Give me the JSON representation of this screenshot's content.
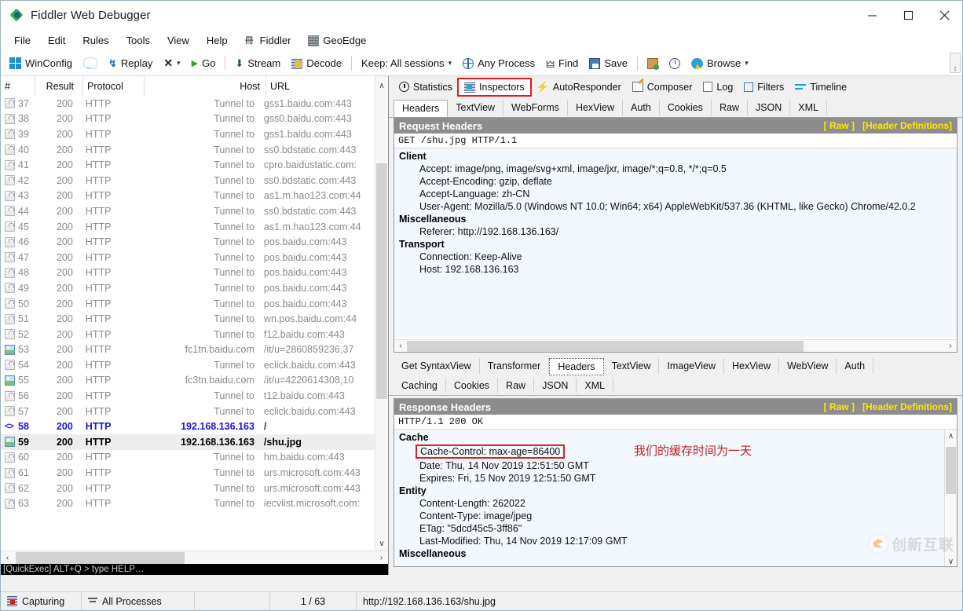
{
  "window": {
    "title": "Fiddler Web Debugger",
    "minimize": "—",
    "maximize": "□",
    "close": "✕"
  },
  "menu": {
    "items": [
      {
        "label": "File",
        "icon": ""
      },
      {
        "label": "Edit",
        "icon": ""
      },
      {
        "label": "Rules",
        "icon": ""
      },
      {
        "label": "Tools",
        "icon": ""
      },
      {
        "label": "View",
        "icon": ""
      },
      {
        "label": "Help",
        "icon": ""
      },
      {
        "label": "Fiddler",
        "icon": "fiddler-book-icon"
      },
      {
        "label": "GeoEdge",
        "icon": "geoedge-icon"
      }
    ]
  },
  "toolbar": {
    "winconfig": "WinConfig",
    "replay": "Replay",
    "go": "Go",
    "stream": "Stream",
    "decode": "Decode",
    "keep": "Keep: All sessions",
    "process": "Any Process",
    "find": "Find",
    "save": "Save",
    "browse": "Browse",
    "dropdown_caret": "▾",
    "x_label": "✕",
    "scroll_glyph": "↕"
  },
  "sessions": {
    "columns": [
      "#",
      "Result",
      "Protocol",
      "Host",
      "URL"
    ],
    "rows": [
      {
        "icon": "lock-icon",
        "num": "37",
        "result": "200",
        "protocol": "HTTP",
        "host": "Tunnel to",
        "url": "gss1.baidu.com:443",
        "style": "normal"
      },
      {
        "icon": "lock-icon",
        "num": "38",
        "result": "200",
        "protocol": "HTTP",
        "host": "Tunnel to",
        "url": "gss0.baidu.com:443",
        "style": "normal"
      },
      {
        "icon": "lock-icon",
        "num": "39",
        "result": "200",
        "protocol": "HTTP",
        "host": "Tunnel to",
        "url": "gss1.baidu.com:443",
        "style": "normal"
      },
      {
        "icon": "lock-icon",
        "num": "40",
        "result": "200",
        "protocol": "HTTP",
        "host": "Tunnel to",
        "url": "ss0.bdstatic.com:443",
        "style": "normal"
      },
      {
        "icon": "lock-icon",
        "num": "41",
        "result": "200",
        "protocol": "HTTP",
        "host": "Tunnel to",
        "url": "cpro.baidustatic.com:",
        "style": "normal"
      },
      {
        "icon": "lock-icon",
        "num": "42",
        "result": "200",
        "protocol": "HTTP",
        "host": "Tunnel to",
        "url": "ss0.bdstatic.com:443",
        "style": "normal"
      },
      {
        "icon": "lock-icon",
        "num": "43",
        "result": "200",
        "protocol": "HTTP",
        "host": "Tunnel to",
        "url": "as1.m.hao123.com:44",
        "style": "normal"
      },
      {
        "icon": "lock-icon",
        "num": "44",
        "result": "200",
        "protocol": "HTTP",
        "host": "Tunnel to",
        "url": "ss0.bdstatic.com:443",
        "style": "normal"
      },
      {
        "icon": "lock-icon",
        "num": "45",
        "result": "200",
        "protocol": "HTTP",
        "host": "Tunnel to",
        "url": "as1.m.hao123.com:44",
        "style": "normal"
      },
      {
        "icon": "lock-icon",
        "num": "46",
        "result": "200",
        "protocol": "HTTP",
        "host": "Tunnel to",
        "url": "pos.baidu.com:443",
        "style": "normal"
      },
      {
        "icon": "lock-icon",
        "num": "47",
        "result": "200",
        "protocol": "HTTP",
        "host": "Tunnel to",
        "url": "pos.baidu.com:443",
        "style": "normal"
      },
      {
        "icon": "lock-icon",
        "num": "48",
        "result": "200",
        "protocol": "HTTP",
        "host": "Tunnel to",
        "url": "pos.baidu.com:443",
        "style": "normal"
      },
      {
        "icon": "lock-icon",
        "num": "49",
        "result": "200",
        "protocol": "HTTP",
        "host": "Tunnel to",
        "url": "pos.baidu.com:443",
        "style": "normal"
      },
      {
        "icon": "lock-icon",
        "num": "50",
        "result": "200",
        "protocol": "HTTP",
        "host": "Tunnel to",
        "url": "pos.baidu.com:443",
        "style": "normal"
      },
      {
        "icon": "lock-icon",
        "num": "51",
        "result": "200",
        "protocol": "HTTP",
        "host": "Tunnel to",
        "url": "wn.pos.baidu.com:44",
        "style": "normal"
      },
      {
        "icon": "lock-icon",
        "num": "52",
        "result": "200",
        "protocol": "HTTP",
        "host": "Tunnel to",
        "url": "f12.baidu.com:443",
        "style": "normal"
      },
      {
        "icon": "image-icon",
        "num": "53",
        "result": "200",
        "protocol": "HTTP",
        "host": "fc1tn.baidu.com",
        "url": "/it/u=2860859236,37",
        "style": "normal"
      },
      {
        "icon": "lock-icon",
        "num": "54",
        "result": "200",
        "protocol": "HTTP",
        "host": "Tunnel to",
        "url": "eclick.baidu.com:443",
        "style": "normal"
      },
      {
        "icon": "image-icon",
        "num": "55",
        "result": "200",
        "protocol": "HTTP",
        "host": "fc3tn.baidu.com",
        "url": "/it/u=4220614308,10",
        "style": "normal"
      },
      {
        "icon": "lock-icon",
        "num": "56",
        "result": "200",
        "protocol": "HTTP",
        "host": "Tunnel to",
        "url": "t12.baidu.com:443",
        "style": "normal"
      },
      {
        "icon": "lock-icon",
        "num": "57",
        "result": "200",
        "protocol": "HTTP",
        "host": "Tunnel to",
        "url": "eclick.baidu.com:443",
        "style": "normal"
      },
      {
        "icon": "html-doc-icon",
        "num": "58",
        "result": "200",
        "protocol": "HTTP",
        "host": "192.168.136.163",
        "url": "/",
        "style": "doc"
      },
      {
        "icon": "image-icon",
        "num": "59",
        "result": "200",
        "protocol": "HTTP",
        "host": "192.168.136.163",
        "url": "/shu.jpg",
        "style": "sel"
      },
      {
        "icon": "lock-icon",
        "num": "60",
        "result": "200",
        "protocol": "HTTP",
        "host": "Tunnel to",
        "url": "hm.baidu.com:443",
        "style": "normal"
      },
      {
        "icon": "lock-icon",
        "num": "61",
        "result": "200",
        "protocol": "HTTP",
        "host": "Tunnel to",
        "url": "urs.microsoft.com:443",
        "style": "normal"
      },
      {
        "icon": "lock-icon",
        "num": "62",
        "result": "200",
        "protocol": "HTTP",
        "host": "Tunnel to",
        "url": "urs.microsoft.com:443",
        "style": "normal"
      },
      {
        "icon": "lock-icon",
        "num": "63",
        "result": "200",
        "protocol": "HTTP",
        "host": "Tunnel to",
        "url": "iecvlist.microsoft.com:",
        "style": "normal"
      }
    ],
    "quickexec": "[QuickExec] ALT+Q > type HELP…",
    "scroll_up": "∧",
    "scroll_down": "∨",
    "scroll_left": "‹",
    "scroll_right": "›"
  },
  "inspector_tabs": {
    "items": [
      {
        "label": "Statistics",
        "icon": "statistics-icon",
        "state": "normal"
      },
      {
        "label": "Inspectors",
        "icon": "inspectors-icon",
        "state": "highlighted"
      },
      {
        "label": "AutoResponder",
        "icon": "autoresponder-icon",
        "state": "normal"
      },
      {
        "label": "Composer",
        "icon": "composer-icon",
        "state": "normal"
      },
      {
        "label": "Log",
        "icon": "log-icon",
        "state": "normal"
      },
      {
        "label": "Filters",
        "icon": "filters-icon",
        "state": "normal"
      },
      {
        "label": "Timeline",
        "icon": "timeline-icon",
        "state": "normal"
      }
    ]
  },
  "request": {
    "tabs": [
      "Headers",
      "TextView",
      "WebForms",
      "HexView",
      "Auth",
      "Cookies",
      "Raw",
      "JSON",
      "XML"
    ],
    "active_tab": "Headers",
    "pane_title": "Request Headers",
    "raw_link": "[ Raw ]",
    "defs_link": "[Header Definitions]",
    "request_line": "GET /shu.jpg HTTP/1.1",
    "groups": [
      {
        "name": "Client",
        "items": [
          "Accept: image/png, image/svg+xml, image/jxr, image/*;q=0.8, */*;q=0.5",
          "Accept-Encoding: gzip, deflate",
          "Accept-Language: zh-CN",
          "User-Agent: Mozilla/5.0 (Windows NT 10.0; Win64; x64) AppleWebKit/537.36 (KHTML, like Gecko) Chrome/42.0.2"
        ]
      },
      {
        "name": "Miscellaneous",
        "items": [
          "Referer: http://192.168.136.163/"
        ]
      },
      {
        "name": "Transport",
        "items": [
          "Connection: Keep-Alive",
          "Host: 192.168.136.163"
        ]
      }
    ]
  },
  "response": {
    "tabs_row1": [
      "Get SyntaxView",
      "Transformer",
      "Headers",
      "TextView",
      "ImageView",
      "HexView",
      "WebView",
      "Auth"
    ],
    "tabs_row2": [
      "Caching",
      "Cookies",
      "Raw",
      "JSON",
      "XML"
    ],
    "active_tab": "Headers",
    "pane_title": "Response Headers",
    "raw_link": "[ Raw ]",
    "defs_link": "[Header Definitions]",
    "status_line": "HTTP/1.1 200 OK",
    "groups": [
      {
        "name": "Cache",
        "items": [
          {
            "text": "Cache-Control: max-age=86400",
            "highlight": true
          },
          {
            "text": "Date: Thu, 14 Nov 2019 12:51:50 GMT",
            "highlight": false
          },
          {
            "text": "Expires: Fri, 15 Nov 2019 12:51:50 GMT",
            "highlight": false
          }
        ]
      },
      {
        "name": "Entity",
        "items": [
          {
            "text": "Content-Length: 262022",
            "highlight": false
          },
          {
            "text": "Content-Type: image/jpeg",
            "highlight": false
          },
          {
            "text": "ETag: \"5dcd45c5-3ff86\"",
            "highlight": false
          },
          {
            "text": "Last-Modified: Thu, 14 Nov 2019 12:17:09 GMT",
            "highlight": false
          }
        ]
      },
      {
        "name": "Miscellaneous",
        "items": []
      }
    ],
    "annotation": "我们的缓存时间为一天"
  },
  "statusbar": {
    "capturing": "Capturing",
    "processes": "All Processes",
    "count": "1 / 63",
    "url": "http://192.168.136.163/shu.jpg"
  },
  "watermark": {
    "text": "创新互联"
  },
  "colors": {
    "accent_red": "#e01b1b",
    "link_yellow": "#ffe600",
    "pane_header": "#8d8d8d",
    "doc_blue": "#1414e0",
    "header_bg": "#f2f8fd"
  }
}
